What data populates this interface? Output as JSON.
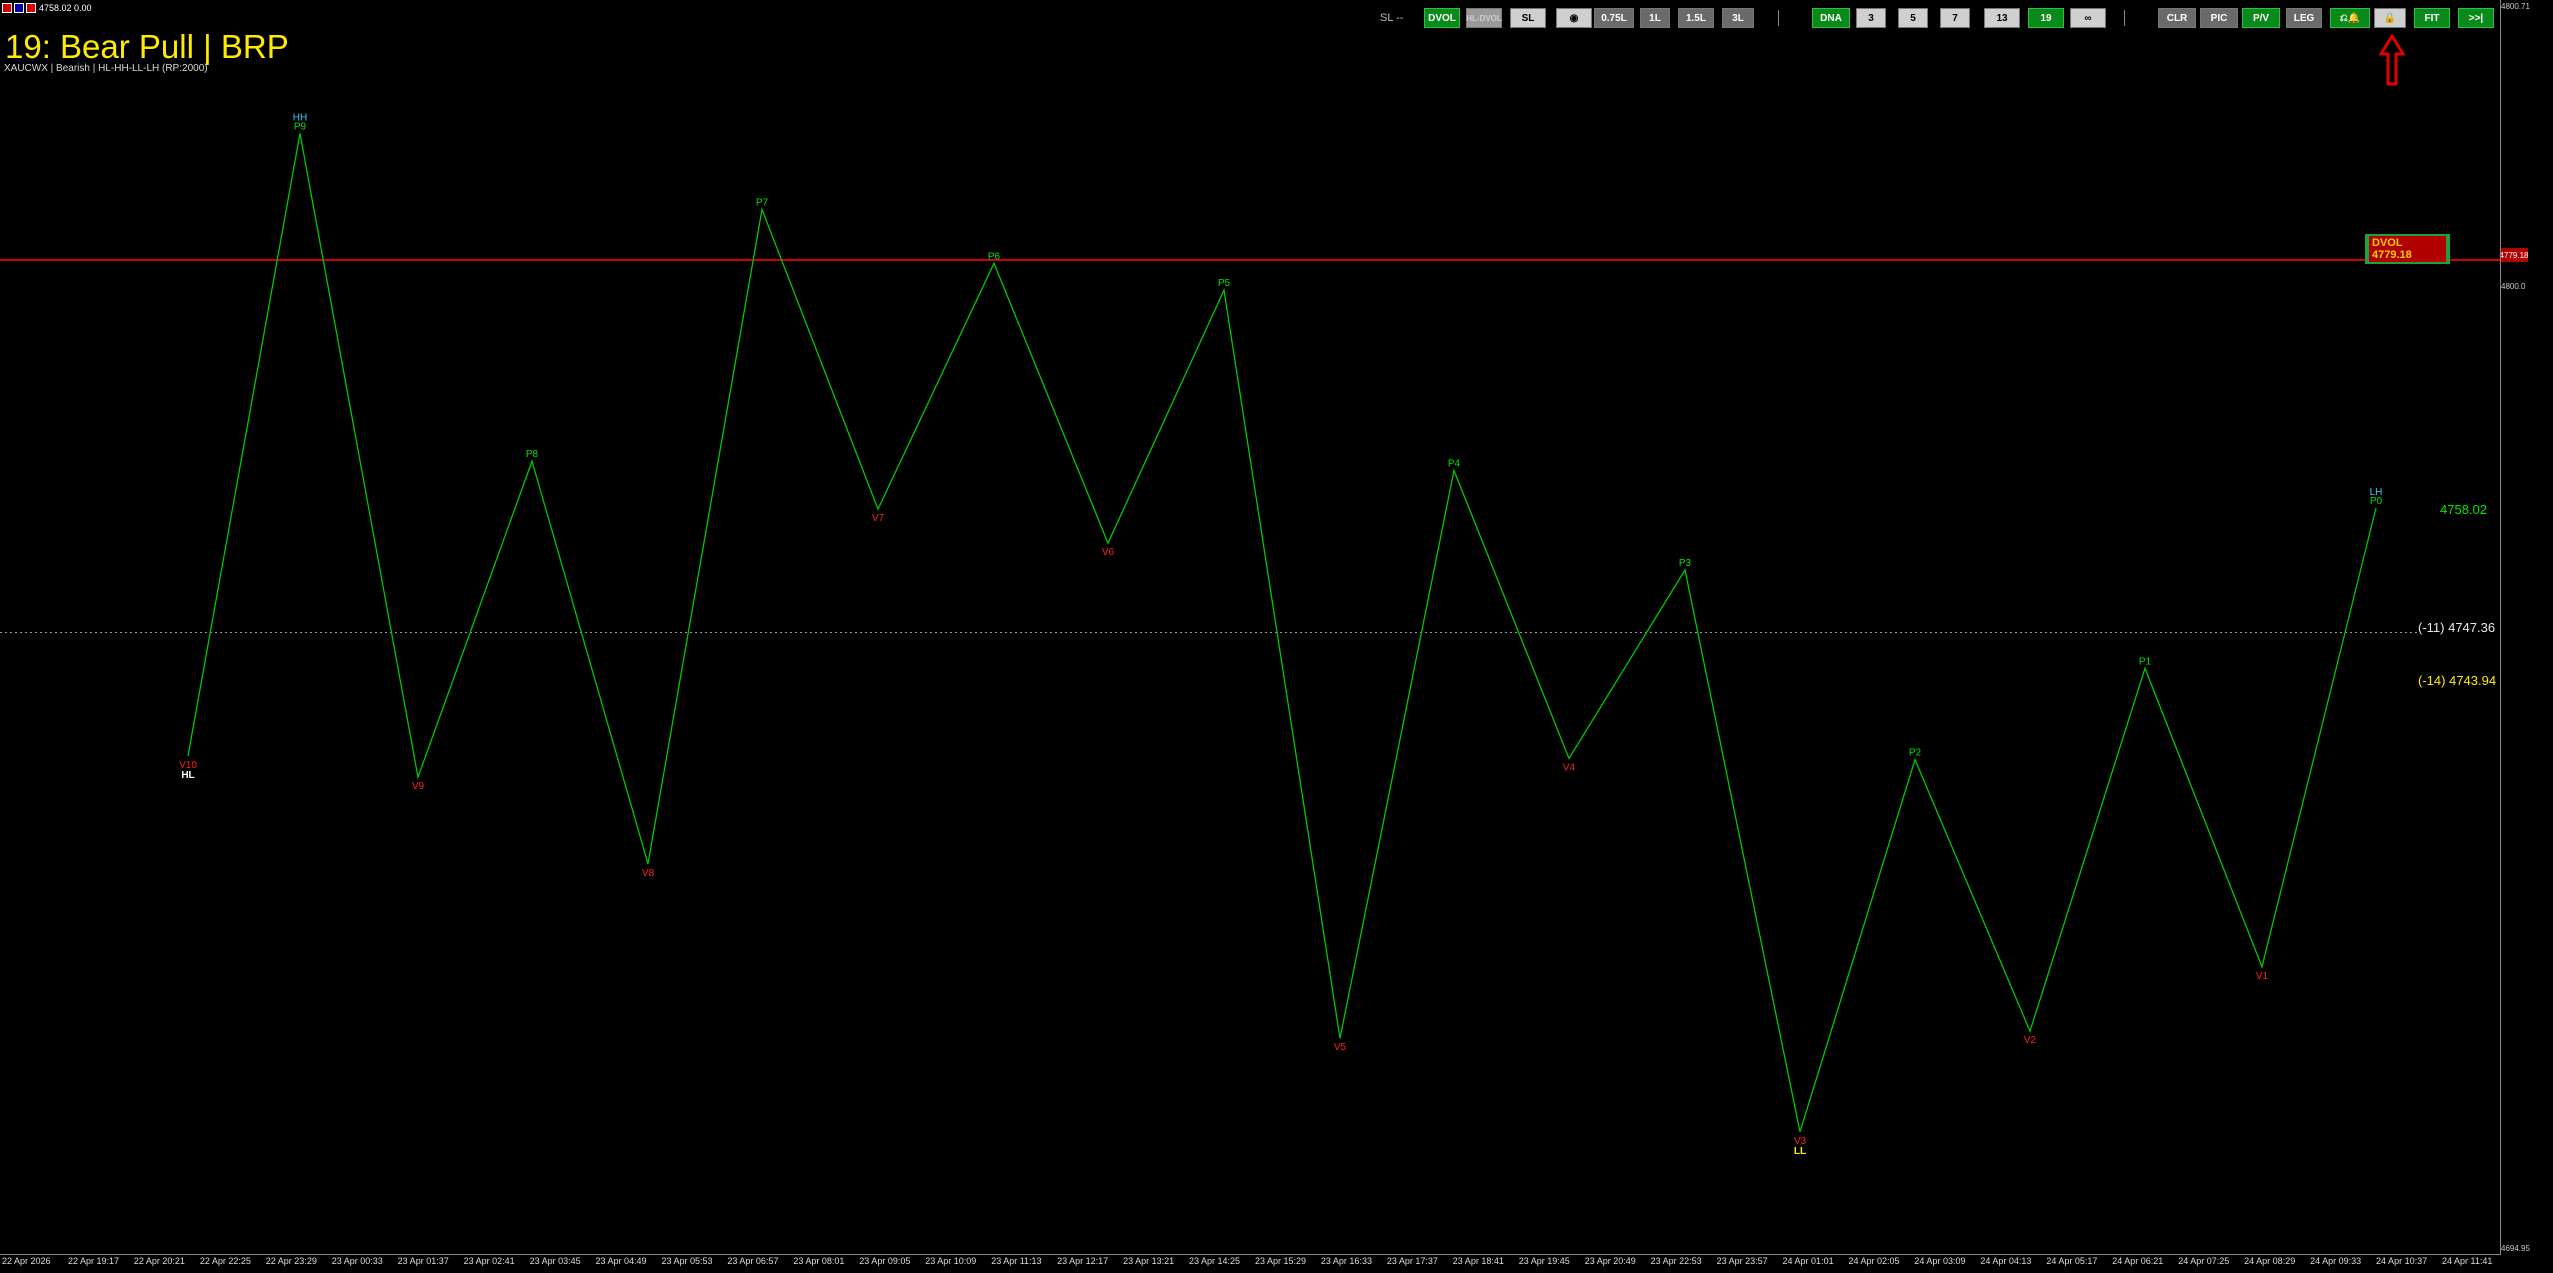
{
  "window": {
    "top_info": "4758.02 0.00"
  },
  "header": {
    "title": "19:  Bear Pull | BRP",
    "subtitle": "XAUCWX | Bearish | HL-HH-LL-LH (RP:2000)"
  },
  "toolbar": {
    "sl_text": "SL --",
    "buttons": [
      {
        "id": "dvol",
        "label": "DVOL",
        "style": "green"
      },
      {
        "id": "hl-dvol",
        "label": "HL-DVOL",
        "style": "disabled"
      },
      {
        "id": "sl",
        "label": "SL",
        "style": "grayl"
      },
      {
        "id": "reset",
        "label": "◉",
        "style": "grayl"
      },
      {
        "id": "l075",
        "label": "0.75L",
        "style": "grayd"
      },
      {
        "id": "l1",
        "label": "1L",
        "style": "grayd"
      },
      {
        "id": "l15",
        "label": "1.5L",
        "style": "grayd"
      },
      {
        "id": "l3",
        "label": "3L",
        "style": "grayd"
      },
      {
        "id": "dna",
        "label": "DNA",
        "style": "green"
      },
      {
        "id": "n3",
        "label": "3",
        "style": "grayl"
      },
      {
        "id": "n5",
        "label": "5",
        "style": "grayl"
      },
      {
        "id": "n7",
        "label": "7",
        "style": "grayl"
      },
      {
        "id": "n13",
        "label": "13",
        "style": "grayl"
      },
      {
        "id": "n19",
        "label": "19",
        "style": "green"
      },
      {
        "id": "ninf",
        "label": "∞",
        "style": "grayl"
      },
      {
        "id": "clr",
        "label": "CLR",
        "style": "grayd"
      },
      {
        "id": "pic",
        "label": "PIC",
        "style": "grayd"
      },
      {
        "id": "pv",
        "label": "P/V",
        "style": "green"
      },
      {
        "id": "leg",
        "label": "LEG",
        "style": "grayd"
      },
      {
        "id": "alert",
        "label": "⎌🔔",
        "style": "green"
      },
      {
        "id": "lock",
        "label": "🔒",
        "style": "grayl"
      },
      {
        "id": "fit",
        "label": "FIT",
        "style": "green"
      },
      {
        "id": "end",
        "label": ">>|",
        "style": "green"
      }
    ]
  },
  "price_labels": {
    "dvol_box": "DVOL 4779.18",
    "red_tag": "4779.18",
    "current": "4758.02",
    "level_11": "(-11)  4747.36",
    "level_14": "(-14)  4743.94",
    "axis_top": "4800.71",
    "axis_mid": "4800.0",
    "axis_bottom": "4694.95"
  },
  "colors": {
    "line": "#00c800",
    "peak": "#00e600",
    "valley": "#ff2020",
    "yellow": "#ffeb00",
    "hline": "#d00000"
  },
  "chart_data": {
    "type": "line",
    "title": "19:  Bear Pull | BRP",
    "ylim": [
      4694.95,
      4800.71
    ],
    "hline": 4779.18,
    "dotted_level": 4747.36,
    "points": [
      {
        "label": "V10",
        "sub": "HL",
        "x": "22 Apr 21:29",
        "y": 4736.8,
        "kind": "valley"
      },
      {
        "label": "P9",
        "sub": "HH",
        "x": "23 Apr 00:15",
        "y": 4790.0,
        "kind": "peak"
      },
      {
        "label": "V9",
        "x": "23 Apr 02:18",
        "y": 4735.0,
        "kind": "valley"
      },
      {
        "label": "P8",
        "x": "23 Apr 04:00",
        "y": 4762.0,
        "kind": "peak"
      },
      {
        "label": "V8",
        "x": "23 Apr 05:45",
        "y": 4727.6,
        "kind": "valley"
      },
      {
        "label": "P7",
        "x": "23 Apr 08:20",
        "y": 4783.5,
        "kind": "peak"
      },
      {
        "label": "V7",
        "x": "23 Apr 11:00",
        "y": 4757.9,
        "kind": "valley"
      },
      {
        "label": "P6",
        "x": "23 Apr 13:20",
        "y": 4778.9,
        "kind": "peak"
      },
      {
        "label": "V6",
        "x": "23 Apr 15:50",
        "y": 4755.0,
        "kind": "valley"
      },
      {
        "label": "P5",
        "x": "23 Apr 18:00",
        "y": 4776.6,
        "kind": "peak"
      },
      {
        "label": "V5",
        "x": "23 Apr 21:55",
        "y": 4712.7,
        "kind": "valley"
      },
      {
        "label": "P4",
        "x": "24 Apr 00:05",
        "y": 4761.2,
        "kind": "peak"
      },
      {
        "label": "V4",
        "x": "24 Apr 02:10",
        "y": 4736.6,
        "kind": "valley"
      },
      {
        "label": "P3",
        "x": "24 Apr 04:40",
        "y": 4752.7,
        "kind": "peak"
      },
      {
        "label": "V3",
        "sub": "LL",
        "x": "24 Apr 06:45",
        "y": 4704.7,
        "kind": "valley"
      },
      {
        "label": "P2",
        "x": "24 Apr 08:35",
        "y": 4736.5,
        "kind": "peak"
      },
      {
        "label": "V2",
        "x": "24 Apr 09:40",
        "y": 4713.3,
        "kind": "valley"
      },
      {
        "label": "P1",
        "x": "24 Apr 10:10",
        "y": 4744.3,
        "kind": "peak"
      },
      {
        "label": "V1",
        "x": "24 Apr 10:50",
        "y": 4718.8,
        "kind": "valley"
      },
      {
        "label": "P0",
        "sub": "LH",
        "x": "24 Apr 11:45",
        "y": 4758.0,
        "kind": "peak"
      }
    ],
    "x_ticks": [
      "22 Apr 2026",
      "22 Apr 19:17",
      "22 Apr 20:21",
      "22 Apr 22:25",
      "22 Apr 23:29",
      "23 Apr 00:33",
      "23 Apr 01:37",
      "23 Apr 02:41",
      "23 Apr 03:45",
      "23 Apr 04:49",
      "23 Apr 05:53",
      "23 Apr 06:57",
      "23 Apr 08:01",
      "23 Apr 09:05",
      "23 Apr 10:09",
      "23 Apr 11:13",
      "23 Apr 12:17",
      "23 Apr 13:21",
      "23 Apr 14:25",
      "23 Apr 15:29",
      "23 Apr 16:33",
      "23 Apr 17:37",
      "23 Apr 18:41",
      "23 Apr 19:45",
      "23 Apr 20:49",
      "23 Apr 22:53",
      "23 Apr 23:57",
      "24 Apr 01:01",
      "24 Apr 02:05",
      "24 Apr 03:09",
      "24 Apr 04:13",
      "24 Apr 05:17",
      "24 Apr 06:21",
      "24 Apr 07:25",
      "24 Apr 08:29",
      "24 Apr 09:33",
      "24 Apr 10:37",
      "24 Apr 11:41"
    ]
  }
}
